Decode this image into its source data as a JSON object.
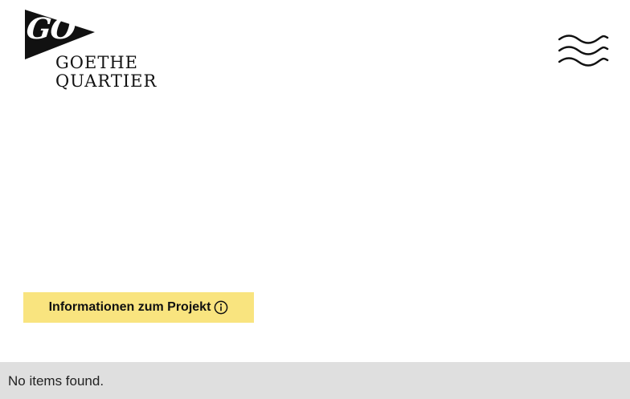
{
  "header": {
    "logo": {
      "mark_text": "GO",
      "line1": "GOETHE",
      "line2": "QUARTIER"
    },
    "menu_icon": "waves-menu-icon"
  },
  "main": {
    "info_button_label": "Informationen zum Projekt",
    "info_icon": "info-circle-icon"
  },
  "footer": {
    "empty_message": "No items found."
  },
  "colors": {
    "background": "#ffffff",
    "accent_yellow": "#f9e47f",
    "footer_bg": "#dfdfdf",
    "ink": "#111111"
  }
}
